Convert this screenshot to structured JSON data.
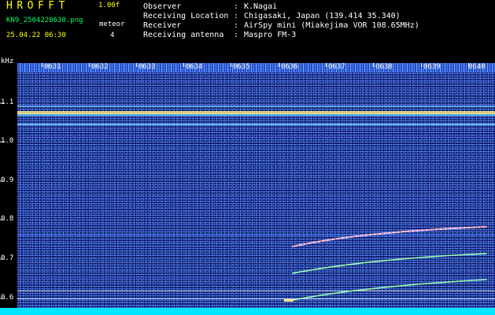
{
  "header": {
    "app_title": "HROFFT",
    "version": "1.00f",
    "filename": "KN9_2504220630.png",
    "meteor_label": "meteor",
    "datetime": "25.04.22 06:30",
    "meteor_count": "4"
  },
  "info": [
    {
      "label": "Observer",
      "value": "K.Nagai"
    },
    {
      "label": "Receiving Location",
      "value": "Chigasaki, Japan (139.414 35.340)"
    },
    {
      "label": "Receiver",
      "value": "AirSpy mini (Miakejima VOR 108.65MHz)"
    },
    {
      "label": "Receiving antenna",
      "value": "Maspro FM-3"
    }
  ],
  "info_separator": ":",
  "y_axis": {
    "unit": "kHz",
    "ticks": [
      "1.1",
      "1.0",
      "0.9",
      "0.8",
      "0.7",
      "0.6"
    ],
    "range": [
      0.58,
      1.16
    ]
  },
  "x_axis": {
    "ticks": [
      "0631",
      "0632",
      "0633",
      "0634",
      "0635",
      "0636",
      "0637",
      "0638",
      "0639",
      "0640"
    ]
  },
  "colors": {
    "background": "#000000",
    "waterfall": "#0a1150",
    "label_yellow": "#ffff00",
    "label_green": "#00ff66",
    "label_white": "#ffffff",
    "carrier": "#ffe680",
    "bottom_band": "#00e5ff"
  }
}
